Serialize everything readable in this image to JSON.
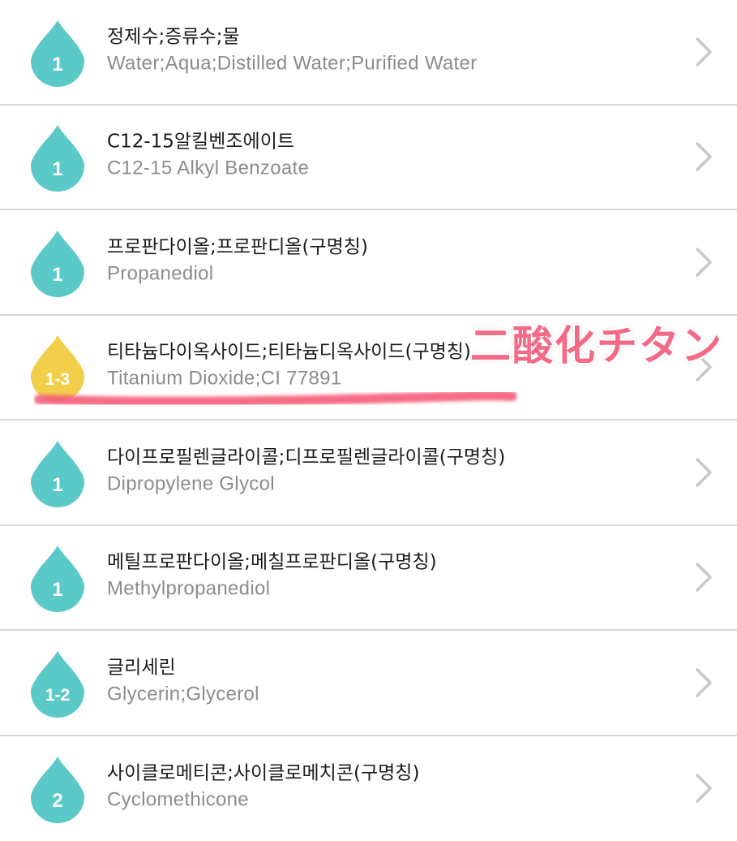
{
  "ingredients": [
    {
      "name_ko": "정제수;증류수;물",
      "name_en": "Water;Aqua;Distilled Water;Purified Water",
      "grade": "1",
      "color": "#5cc9c9"
    },
    {
      "name_ko": "C12-15알킬벤조에이트",
      "name_en": "C12-15 Alkyl Benzoate",
      "grade": "1",
      "color": "#5cc9c9"
    },
    {
      "name_ko": "프로판다이올;프로판디올(구명칭)",
      "name_en": "Propanediol",
      "grade": "1",
      "color": "#5cc9c9"
    },
    {
      "name_ko": "티타늄다이옥사이드;티타늄디옥사이드(구명칭)",
      "name_en": "Titanium Dioxide;CI 77891",
      "grade": "1-3",
      "color": "#f2cf4a"
    },
    {
      "name_ko": "다이프로필렌글라이콜;디프로필렌글라이콜(구명칭)",
      "name_en": "Dipropylene Glycol",
      "grade": "1",
      "color": "#5cc9c9"
    },
    {
      "name_ko": "메틸프로판다이올;메칠프로판디올(구명칭)",
      "name_en": "Methylpropanediol",
      "grade": "1",
      "color": "#5cc9c9"
    },
    {
      "name_ko": "글리세린",
      "name_en": "Glycerin;Glycerol",
      "grade": "1-2",
      "color": "#5cc9c9"
    },
    {
      "name_ko": "사이클로메티콘;사이클로메치콘(구명칭)",
      "name_en": "Cyclomethicone",
      "grade": "2",
      "color": "#5cc9c9"
    }
  ],
  "annotation": {
    "text": "二酸化チタン",
    "color": "#f26a86",
    "underline_color": "#f55f7c"
  }
}
